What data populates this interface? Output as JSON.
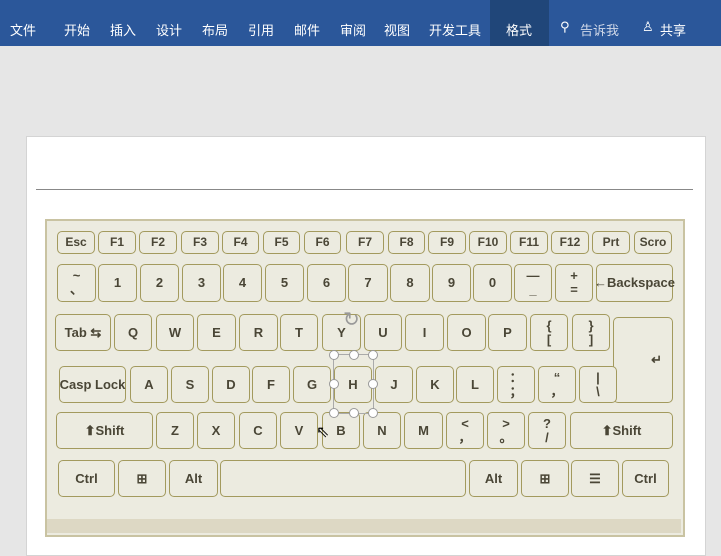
{
  "ribbon": {
    "tabs": [
      "文件",
      "开始",
      "插入",
      "设计",
      "布局",
      "引用",
      "邮件",
      "审阅",
      "视图",
      "开发工具",
      "格式"
    ],
    "tell_me": "告诉我",
    "share": "共享"
  },
  "keyboard": {
    "rows": [
      [
        "Esc",
        "F1",
        "F2",
        "F3",
        "F4",
        "F5",
        "F6",
        "F7",
        "F8",
        "F9",
        "F10",
        "F11",
        "F12",
        "Prt",
        "Scro"
      ],
      [
        "~\n、",
        "1",
        "2",
        "3",
        "4",
        "5",
        "6",
        "7",
        "8",
        "9",
        "0",
        "—\n_",
        "+\n=",
        "←Backspace"
      ],
      [
        "Tab ⇆",
        "Q",
        "W",
        "E",
        "R",
        "T",
        "Y",
        "U",
        "I",
        "O",
        "P",
        "{\n[",
        "}\n]",
        "↵"
      ],
      [
        "Casp Lock",
        "A",
        "S",
        "D",
        "F",
        "G",
        "H",
        "J",
        "K",
        "L",
        "：\n；",
        "“\n，",
        "|\n\\"
      ],
      [
        "⬆Shift",
        "Z",
        "X",
        "C",
        "V",
        "B",
        "N",
        "M",
        "<\n，",
        ">\n。",
        "?\n/",
        "⬆Shift"
      ],
      [
        "Ctrl",
        "⊞",
        "Alt",
        "",
        "Alt",
        "⊞",
        "☰",
        "Ctrl"
      ]
    ]
  }
}
